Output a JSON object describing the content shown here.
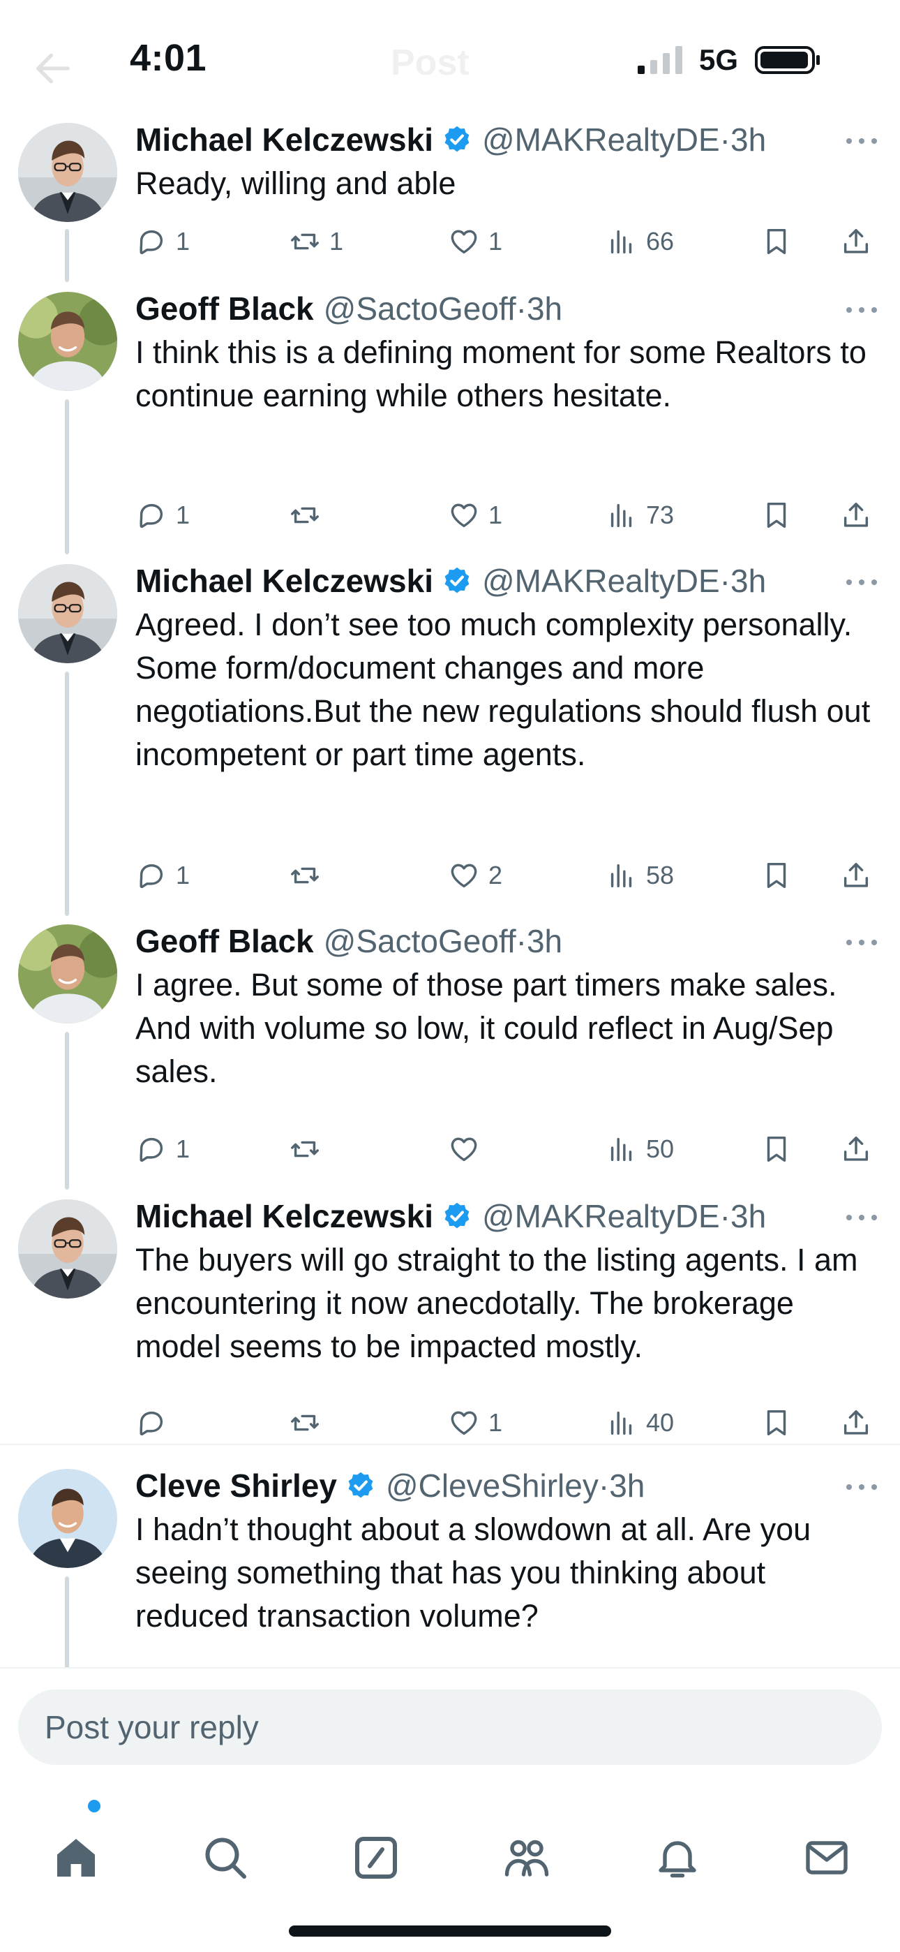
{
  "status_bar": {
    "time": "4:01",
    "network": "5G",
    "ghost_title": "Post"
  },
  "tweets": [
    {
      "name": "Michael Kelczewski",
      "verified": true,
      "handle": "@MAKRealtyDE",
      "separator": "·",
      "time": "3h",
      "text": "Ready, willing and able",
      "replies": "1",
      "reposts": "1",
      "likes": "1",
      "views": "66"
    },
    {
      "name": "Geoff Black",
      "verified": false,
      "handle": "@SactoGeoff",
      "separator": "·",
      "time": "3h",
      "text": "I think this is a defining moment for some Realtors to continue earning while others hesitate.",
      "replies": "1",
      "reposts": "",
      "likes": "1",
      "views": "73"
    },
    {
      "name": "Michael Kelczewski",
      "verified": true,
      "handle": "@MAKRealtyDE",
      "separator": "·",
      "time": "3h",
      "text": "Agreed. I don’t see too much complexity personally. Some form/document changes and more negotiations.But the new regulations should flush out incompetent or part time agents.",
      "replies": "1",
      "reposts": "",
      "likes": "2",
      "views": "58"
    },
    {
      "name": "Geoff Black",
      "verified": false,
      "handle": "@SactoGeoff",
      "separator": "·",
      "time": "3h",
      "text": "I agree. But some of those part timers make sales.  And with volume so low, it could reflect in Aug/Sep sales.",
      "replies": "1",
      "reposts": "",
      "likes": "",
      "views": "50"
    },
    {
      "name": "Michael Kelczewski",
      "verified": true,
      "handle": "@MAKRealtyDE",
      "separator": "·",
      "time": "3h",
      "text": "The buyers will go straight to the listing agents. I am encountering it now anecdotally. The brokerage model seems to be impacted mostly.",
      "replies": "",
      "reposts": "",
      "likes": "1",
      "views": "40"
    },
    {
      "name": "Cleve Shirley",
      "verified": true,
      "handle": "@CleveShirley",
      "separator": "·",
      "time": "3h",
      "text": "I hadn’t thought about a slowdown at all. Are you seeing something that has you thinking about reduced transaction volume?"
    }
  ],
  "reply": {
    "placeholder": "Post your reply"
  },
  "tabs": [
    "home",
    "search",
    "compose",
    "communities",
    "notifications",
    "messages"
  ],
  "colors": {
    "accent": "#1d9bf0",
    "text": "#0f1419",
    "secondary": "#536471",
    "thread_line": "#cfd9de",
    "divider": "#eff3f4"
  },
  "icons": {
    "reply": "reply-icon",
    "repost": "repost-icon",
    "like": "heart-icon",
    "views": "views-icon",
    "bookmark": "bookmark-icon",
    "share": "share-icon"
  }
}
